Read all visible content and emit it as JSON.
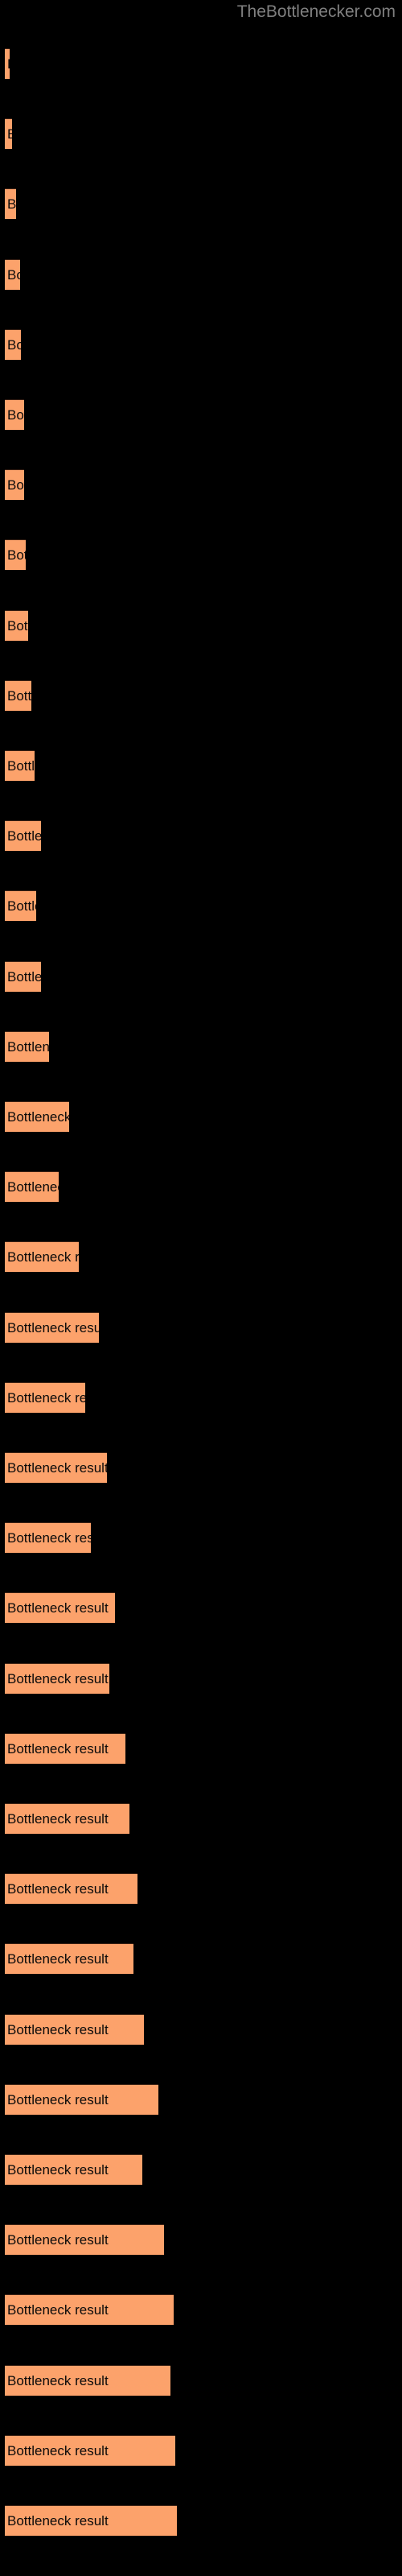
{
  "chart_data": {
    "type": "bar",
    "orientation": "horizontal",
    "title": "TheBottlenecker.com",
    "xlabel": "",
    "ylabel": "",
    "grid": false,
    "legend": null,
    "bar_color": "#fca26b",
    "bar_edge_color": "#3a2013",
    "background_color": "#000000",
    "title_color": "#7f7f7f",
    "label_color": "#0a0a0a",
    "bar_label": "Bottleneck result",
    "xlim": [
      0,
      500
    ],
    "categories": [
      "Bottleneck result",
      "Bottleneck result",
      "Bottleneck result",
      "Bottleneck result",
      "Bottleneck result",
      "Bottleneck result",
      "Bottleneck result",
      "Bottleneck result",
      "Bottleneck result",
      "Bottleneck result",
      "Bottleneck result",
      "Bottleneck result",
      "Bottleneck result",
      "Bottleneck result",
      "Bottleneck result",
      "Bottleneck result",
      "Bottleneck result",
      "Bottleneck result",
      "Bottleneck result",
      "Bottleneck result",
      "Bottleneck result",
      "Bottleneck result",
      "Bottleneck result",
      "Bottleneck result",
      "Bottleneck result",
      "Bottleneck result",
      "Bottleneck result",
      "Bottleneck result",
      "Bottleneck result",
      "Bottleneck result",
      "Bottleneck result",
      "Bottleneck result",
      "Bottleneck result",
      "Bottleneck result",
      "Bottleneck result",
      "Bottleneck result"
    ],
    "values": [
      6,
      9,
      14,
      19,
      20,
      24,
      24,
      26,
      29,
      33,
      37,
      45,
      39,
      45,
      55,
      80,
      67,
      92,
      117,
      100,
      127,
      107,
      137,
      130,
      150,
      155,
      165,
      160,
      173,
      191,
      171,
      198,
      210,
      206,
      212,
      214
    ]
  }
}
